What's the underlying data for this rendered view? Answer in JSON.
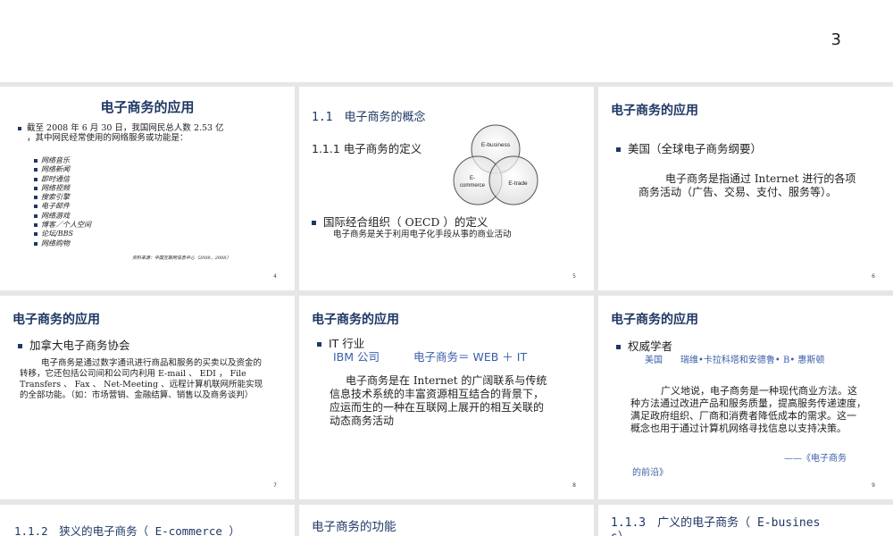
{
  "page_number": "3",
  "slides": [
    {
      "title": "电子商务的应用",
      "bullet": "截至 2008 年 6 月 30 日，我国网民总人数 2.53 亿",
      "bullet2": "，其中网民经常使用的网络服务或功能是：",
      "items": [
        "网络音乐",
        "网络新闻",
        "即时通信",
        "网络视频",
        "搜索引擎",
        "电子邮件",
        "网络游戏",
        "博客／个人空间",
        "论坛/BBS",
        "网络购物"
      ],
      "source": "资料来源：中国互联网信息中心（2008，2008）",
      "number": "4"
    },
    {
      "title": "1.1　电子商务的概念",
      "subtitle": "1.1.1  电子商务的定义",
      "venn_labels": [
        "E-business",
        "E-commerce",
        "E-trade"
      ],
      "bullet": "国际经合组织（ OECD ）的定义",
      "text": "电子商务是关于利用电子化手段从事的商业活动",
      "number": "5"
    },
    {
      "title": "电子商务的应用",
      "bullet": "美国（全球电子商务纲要）",
      "text1": "电子商务是指通过 Internet  进行的各项",
      "text2": "商务活动（广告、交易、支付、服务等）。",
      "number": "6"
    },
    {
      "title": "电子商务的应用",
      "bullet": "加拿大电子商务协会",
      "lines": [
        "电子商务是通过数字通讯进行商品和服务的买卖以及资金的",
        "转移，它还包括公司间和公司内利用 E-mail 、 EDI ， File",
        "Transfers 、 Fax 、 Net-Meeting 、远程计算机联网所能实现",
        "的全部功能。（如：市场营销、金融结算、销售以及商务谈判）"
      ],
      "number": "7"
    },
    {
      "title": "电子商务的应用",
      "bullet": "IT 行业",
      "ibm": "IBM 公司",
      "formula": "电子商务＝ WEB ＋ IT",
      "lines": [
        "电子商务是在 Internet 的广阔联系与传统",
        "信息技术系统的丰富资源相互结合的背景下，",
        "应运而生的一种在互联网上展开的相互关联的",
        "动态商务活动"
      ],
      "number": "8"
    },
    {
      "title": "电子商务的应用",
      "bullet": "权威学者",
      "authors": "美国　　瑞维•卡拉科塔和安德鲁• B• 惠斯顿",
      "lines": [
        "广义地说，电子商务是一种现代商业方法。这",
        "种方法通过改进产品和服务质量，提高服务传递速度，",
        "满足政府组织、厂商和消费者降低成本的需求。这一",
        "概念也用于通过计算机网络寻找信息以支持决策。"
      ],
      "cite1": "——《电子商务",
      "cite2": "的前沿》",
      "number": "9"
    },
    {
      "title": "1.1.2　狭义的电子商务（ E-commerce ）"
    },
    {
      "title": "电子商务的功能"
    },
    {
      "title": "1.1.3　广义的电子商务（ E-busines",
      "title2": "s）"
    }
  ]
}
